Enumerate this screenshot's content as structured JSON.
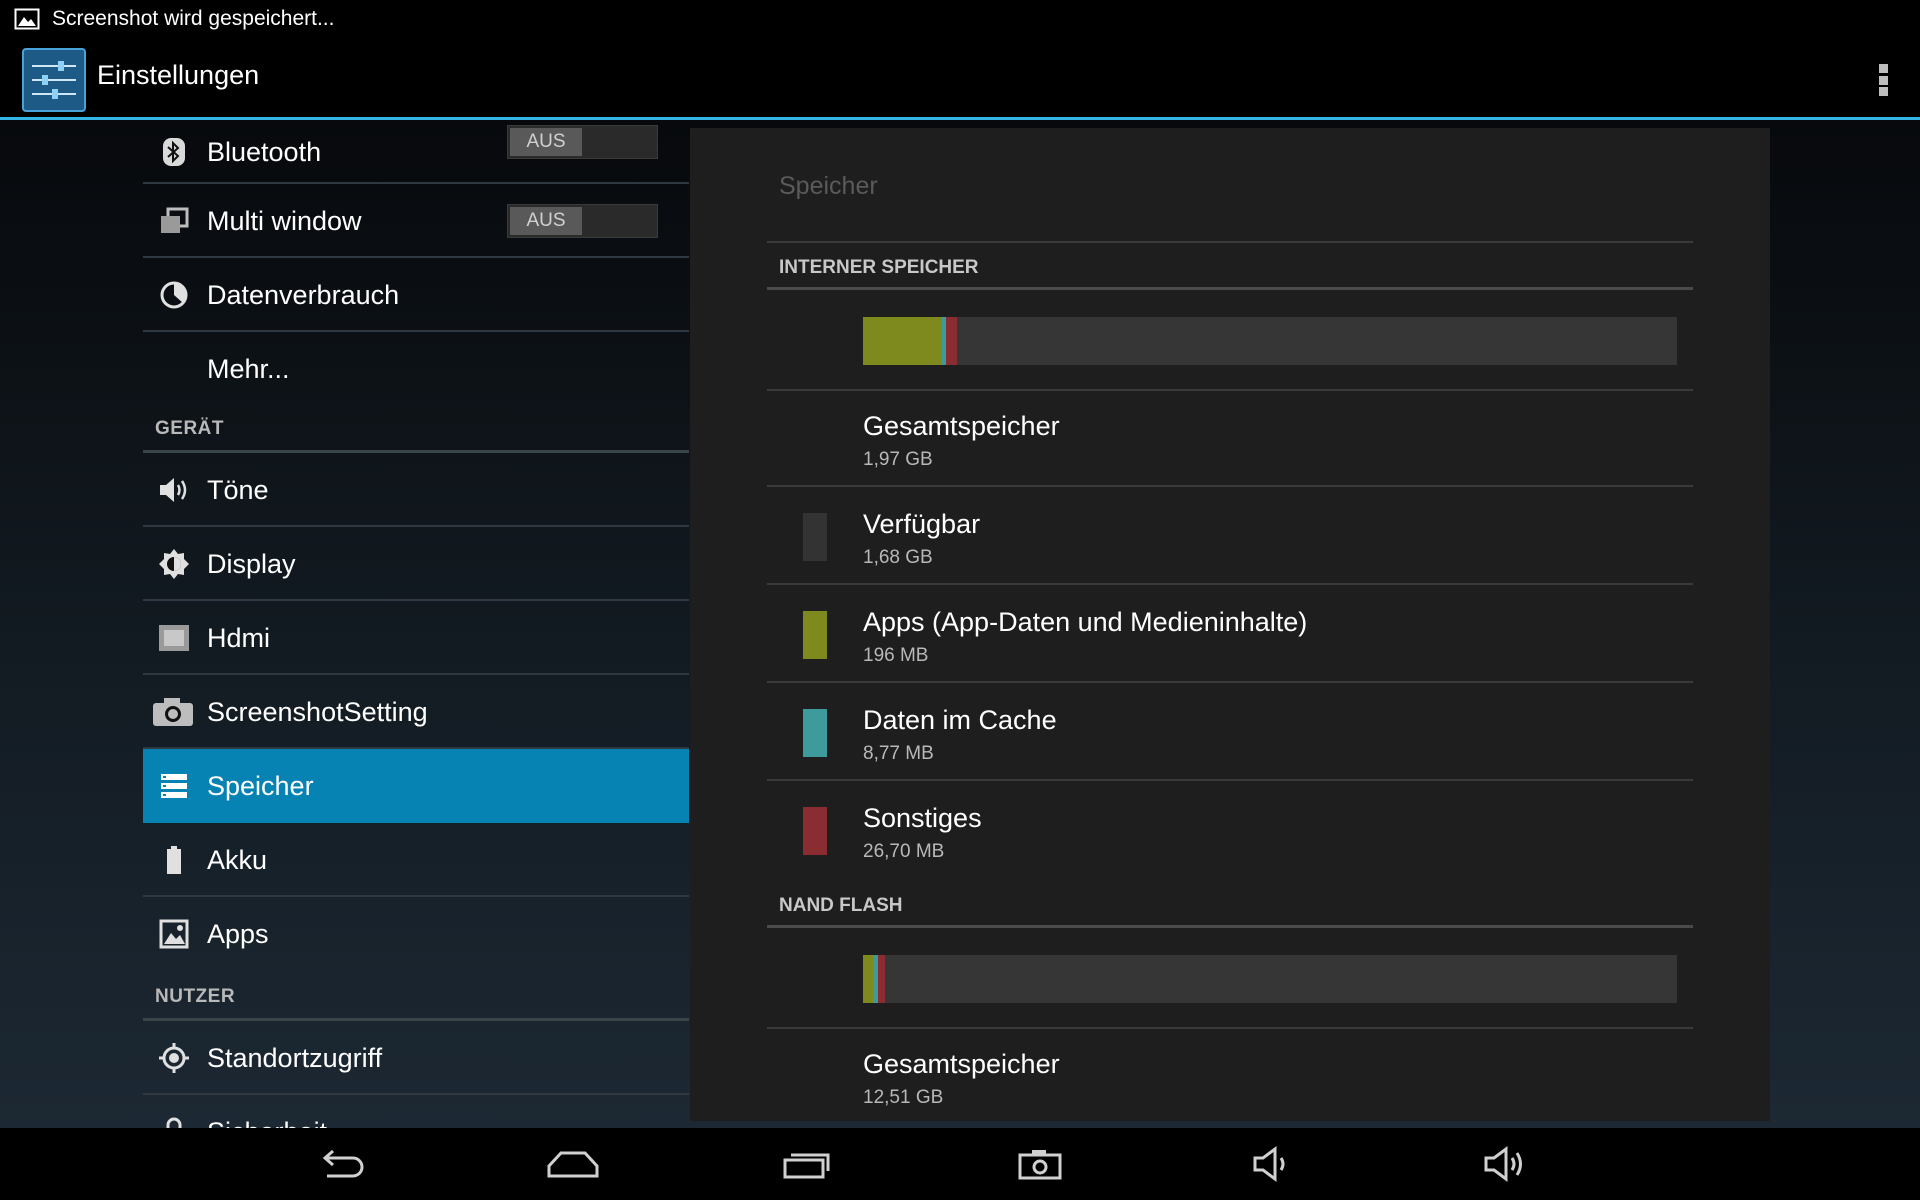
{
  "status_bar": {
    "notification_text": "Screenshot wird gespeichert..."
  },
  "action_bar": {
    "title": "Einstellungen"
  },
  "sidebar": {
    "wireless_items": [
      {
        "label": "Bluetooth",
        "toggle": "AUS"
      },
      {
        "label": "Multi window",
        "toggle": "AUS"
      },
      {
        "label": "Datenverbrauch"
      },
      {
        "label": "Mehr..."
      }
    ],
    "device_header": "GERÄT",
    "device_items": [
      {
        "label": "Töne"
      },
      {
        "label": "Display"
      },
      {
        "label": "Hdmi"
      },
      {
        "label": "ScreenshotSetting"
      },
      {
        "label": "Speicher",
        "selected": true
      },
      {
        "label": "Akku"
      },
      {
        "label": "Apps"
      }
    ],
    "user_header": "NUTZER",
    "user_items": [
      {
        "label": "Standortzugriff"
      },
      {
        "label": "Sicherheit"
      }
    ]
  },
  "storage": {
    "title": "Speicher",
    "internal": {
      "header": "INTERNER SPEICHER",
      "usage": {
        "apps": 0.097,
        "cache": 0.0044,
        "other": 0.013
      },
      "items": [
        {
          "label": "Gesamtspeicher",
          "value": "1,97 GB"
        },
        {
          "label": "Verfügbar",
          "value": "1,68 GB",
          "color": "#333333"
        },
        {
          "label": "Apps (App-Daten und Medieninhalte)",
          "value": "196 MB",
          "color": "#7e8a1d"
        },
        {
          "label": "Daten im Cache",
          "value": "8,77 MB",
          "color": "#3d9b9b"
        },
        {
          "label": "Sonstiges",
          "value": "26,70 MB",
          "color": "#8b2c32"
        }
      ]
    },
    "nand": {
      "header": "NAND FLASH",
      "usage": {
        "apps": 0.012,
        "cache": 0.006,
        "other": 0.008
      },
      "items": [
        {
          "label": "Gesamtspeicher",
          "value": "12,51 GB"
        }
      ]
    }
  },
  "colors": {
    "accent": "#33b5e5",
    "selected": "#0682b3",
    "apps": "#7e8a1d",
    "cache": "#3d9b9b",
    "other": "#8b2c32"
  },
  "nav_icons": [
    "back-icon",
    "home-icon",
    "recents-icon",
    "screenshot-icon",
    "volume-down-icon",
    "volume-up-icon"
  ]
}
